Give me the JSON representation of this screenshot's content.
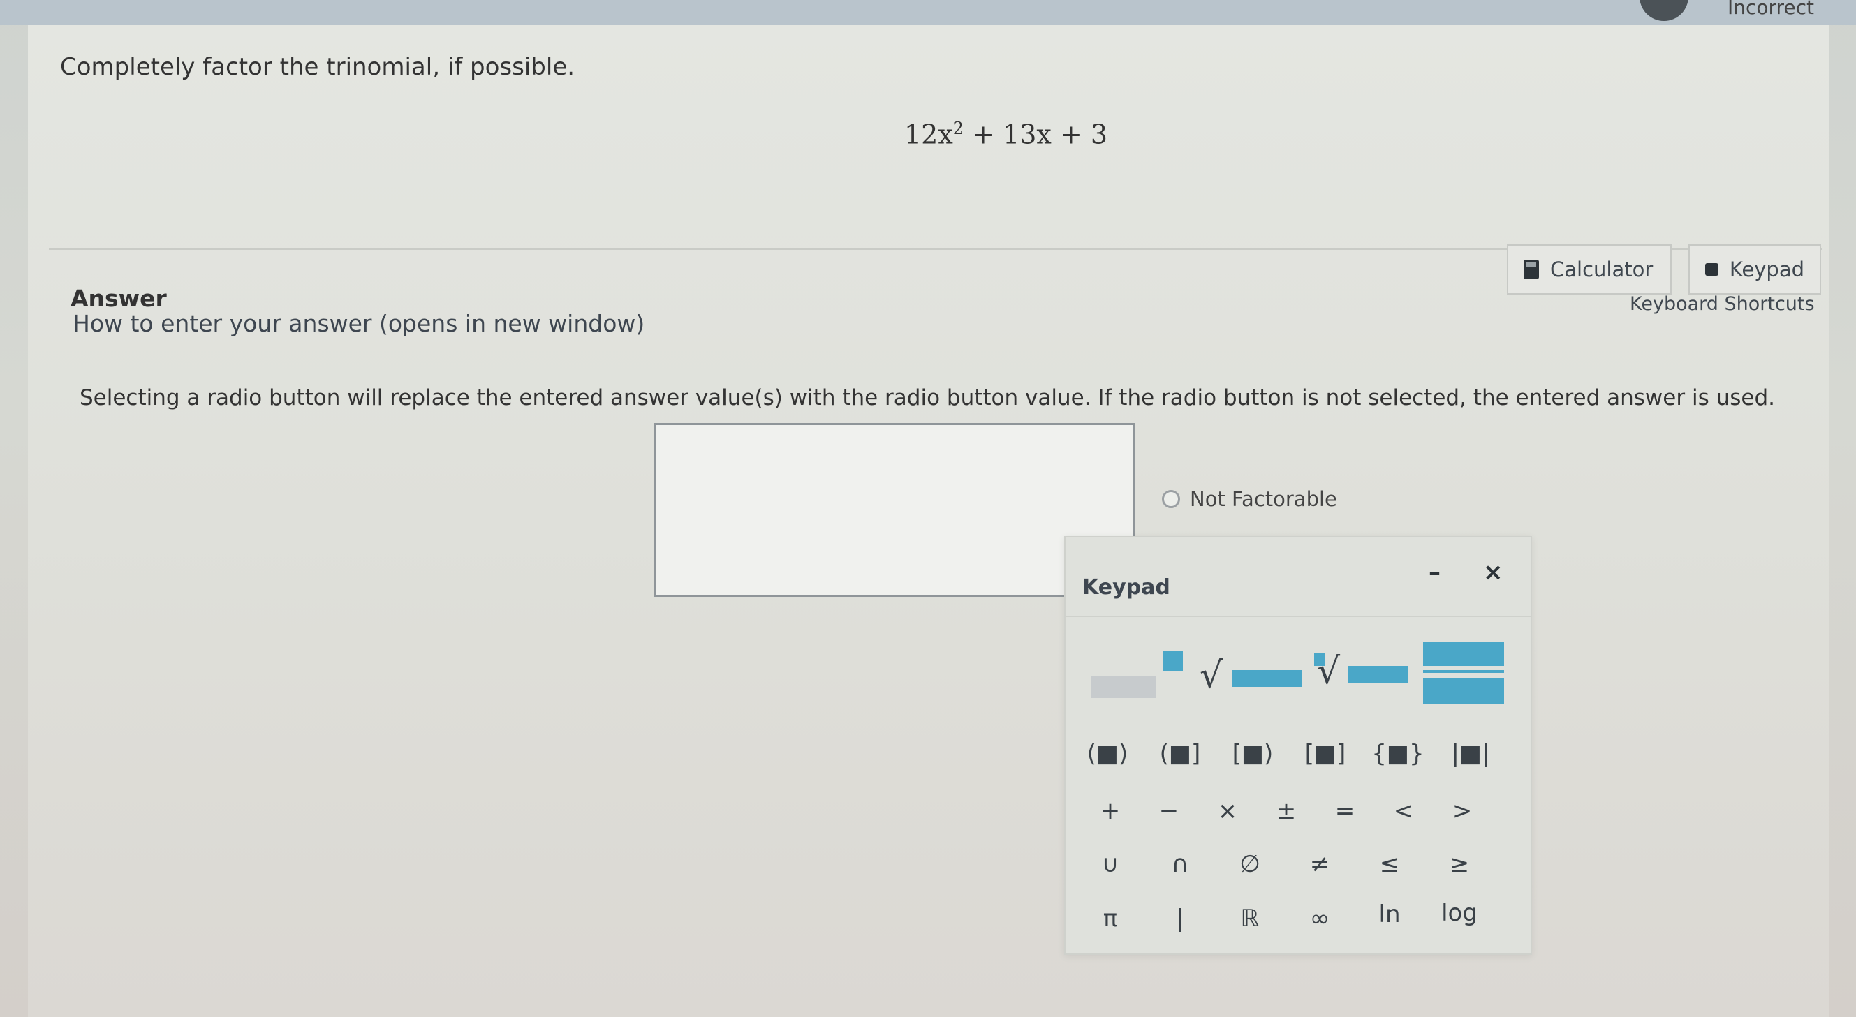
{
  "topbar": {
    "right_label": "Incorrect"
  },
  "question": {
    "prompt": "Completely factor the trinomial, if possible.",
    "expression": {
      "coef_a": "12x",
      "exponent": "2",
      "rest": " + 13x + 3"
    }
  },
  "answer": {
    "title": "Answer",
    "howto_link": "How to enter your answer (opens in new window)",
    "radio_note": "Selecting a radio button will replace the entered answer value(s) with the radio button value. If the radio button is not selected, the entered answer is used.",
    "input_value": "",
    "radio_option": "Not Factorable"
  },
  "tools": {
    "calculator_label": "Calculator",
    "keypad_label": "Keypad",
    "shortcuts_label": "Keyboard Shortcuts"
  },
  "keypad": {
    "title": "Keypad",
    "minimize": "–",
    "close": "×",
    "row_brackets": [
      "(■)",
      "(■]",
      "[■)",
      "[■]",
      "{■}",
      "|■|"
    ],
    "row_ops": [
      "+",
      "−",
      "×",
      "±",
      "=",
      "<",
      ">"
    ],
    "row_sets": [
      "∪",
      "∩",
      "∅",
      "≠",
      "≤",
      "≥"
    ],
    "row_misc": [
      "π",
      "|",
      "ℝ",
      "∞",
      "ln",
      "log"
    ]
  }
}
